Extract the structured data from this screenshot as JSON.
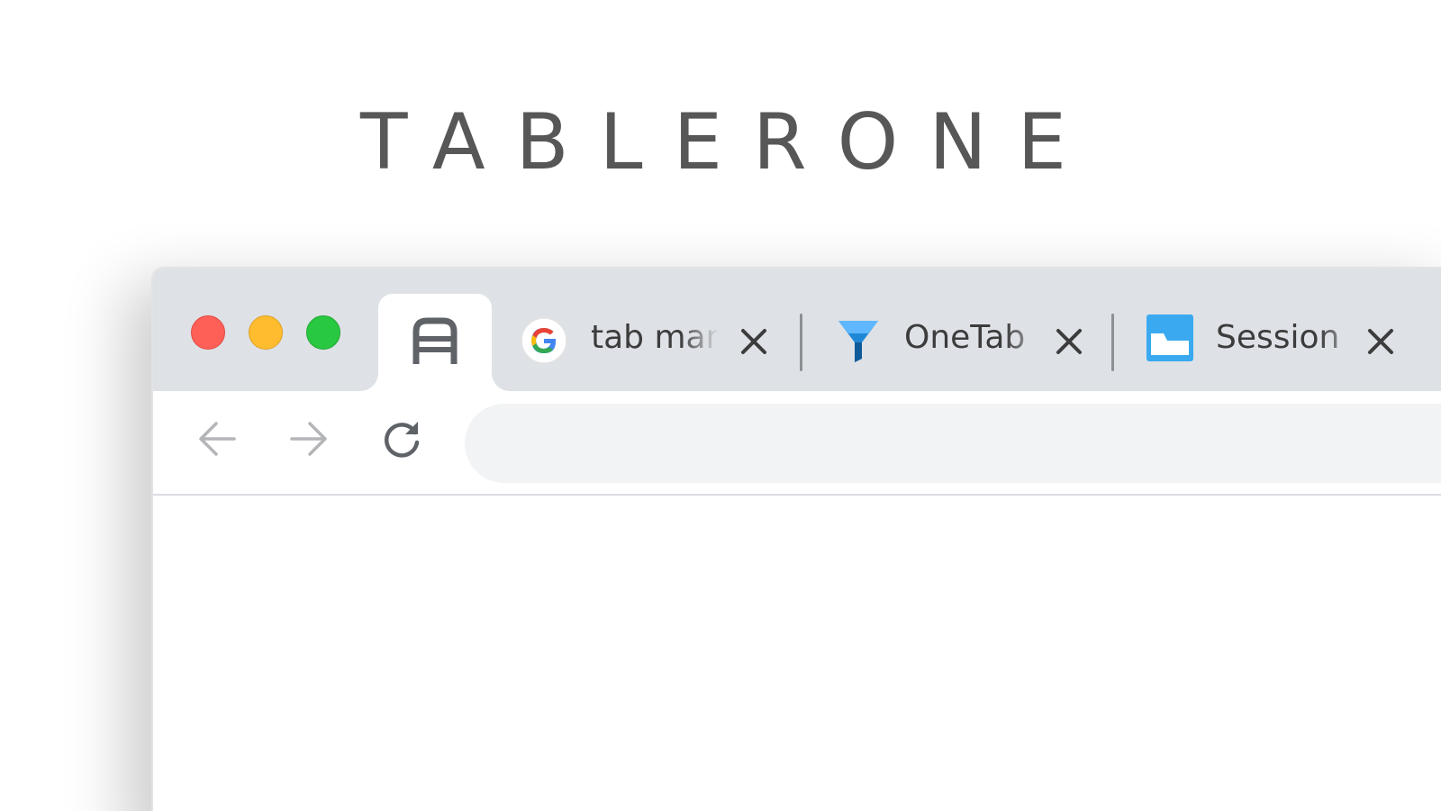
{
  "brand": {
    "title": "TABLERONE"
  },
  "browser": {
    "window_controls": [
      {
        "name": "close",
        "color": "#fe5f57"
      },
      {
        "name": "minimize",
        "color": "#febc2e"
      },
      {
        "name": "maximize",
        "color": "#28c840"
      }
    ],
    "tabs": [
      {
        "title": "",
        "icon": "tablerone-logo-icon",
        "active": true
      },
      {
        "title": "tab man",
        "icon": "google-icon",
        "active": false
      },
      {
        "title": "OneTab",
        "icon": "onetab-funnel-icon",
        "active": false
      },
      {
        "title": "Session",
        "icon": "session-buddy-icon",
        "active": false
      }
    ],
    "toolbar": {
      "back_icon": "arrow-left-icon",
      "forward_icon": "arrow-right-icon",
      "reload_icon": "reload-icon",
      "omnibox_value": ""
    }
  },
  "colors": {
    "tabstrip": "#dee1e6",
    "omnibox": "#f1f3f4",
    "brand_text": "#575757"
  }
}
